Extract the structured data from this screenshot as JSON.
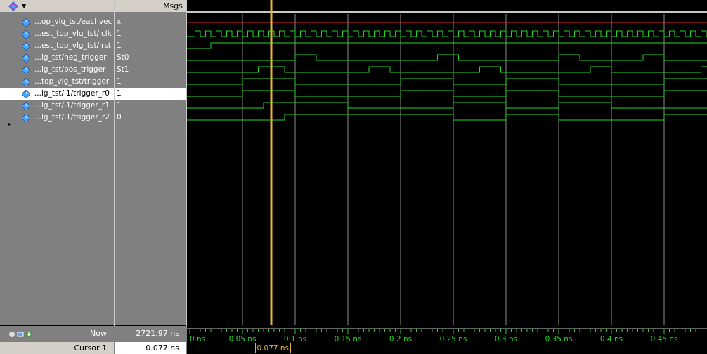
{
  "header": {
    "msgs_label": "Msgs"
  },
  "signals": [
    {
      "name": "...op_vlg_tst/eachvec",
      "value": "x"
    },
    {
      "name": "...est_top_vlg_tst/iclk",
      "value": "1"
    },
    {
      "name": "...est_top_vlg_tst/irst",
      "value": "1"
    },
    {
      "name": "...lg_tst/neg_trigger",
      "value": "St0"
    },
    {
      "name": "...lg_tst/pos_trigger",
      "value": "St1"
    },
    {
      "name": "...top_vlg_tst/trigger",
      "value": "1"
    },
    {
      "name": "...lg_tst/i1/trigger_r0",
      "value": "1"
    },
    {
      "name": "...lg_tst/i1/trigger_r1",
      "value": "1"
    },
    {
      "name": "...lg_tst/i1/trigger_r2",
      "value": "0"
    }
  ],
  "selected_signal_index": 6,
  "status": {
    "now_label": "Now",
    "now_value": "2721.97 ns",
    "cursor_label": "Cursor 1",
    "cursor_value": "0.077 ns"
  },
  "cursor": {
    "time_ns": 0.077,
    "flag_label": "0.077 ns"
  },
  "timeline": {
    "range_ns": [
      0,
      0.48
    ],
    "major_ticks": [
      "0 ns",
      "0.05 ns",
      "0.1 ns",
      "0.15 ns",
      "0.2 ns",
      "0.25 ns",
      "0.3 ns",
      "0.35 ns",
      "0.4 ns",
      "0.45 ns"
    ]
  },
  "colors": {
    "wave": "#22d822",
    "x_wave": "#e03030",
    "cursor": "#e8b341",
    "grid": "#8c8c8c",
    "pane_bg": "#808080"
  }
}
